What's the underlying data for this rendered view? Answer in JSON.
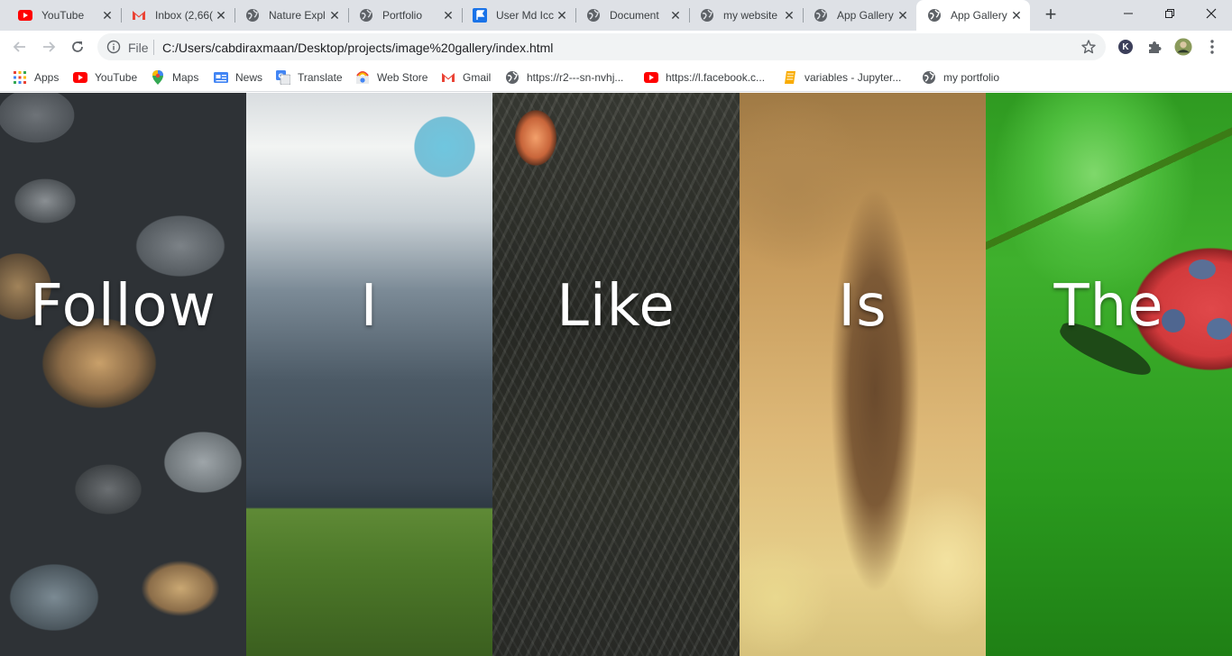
{
  "browser": {
    "tabs": [
      {
        "title": "YouTube",
        "icon": "youtube-icon",
        "active": false
      },
      {
        "title": "Inbox (2,66(",
        "icon": "gmail-icon",
        "active": false
      },
      {
        "title": "Nature Expl",
        "icon": "globe-icon",
        "active": false
      },
      {
        "title": "Portfolio",
        "icon": "globe-icon",
        "active": false
      },
      {
        "title": "User Md Icc",
        "icon": "flag-icon",
        "active": false
      },
      {
        "title": "Document",
        "icon": "globe-icon",
        "active": false
      },
      {
        "title": "my website",
        "icon": "globe-icon",
        "active": false
      },
      {
        "title": "App Gallery",
        "icon": "globe-icon",
        "active": false
      },
      {
        "title": "App Gallery",
        "icon": "globe-icon",
        "active": true
      }
    ],
    "address": {
      "scheme_label": "File",
      "url": "C:/Users/cabdiraxmaan/Desktop/projects/image%20gallery/index.html"
    },
    "profile_initial": "K",
    "bookmarks": [
      {
        "label": "Apps",
        "icon": "apps-grid-icon"
      },
      {
        "label": "YouTube",
        "icon": "youtube-icon"
      },
      {
        "label": "Maps",
        "icon": "maps-pin-icon"
      },
      {
        "label": "News",
        "icon": "news-icon"
      },
      {
        "label": "Translate",
        "icon": "translate-icon"
      },
      {
        "label": "Web Store",
        "icon": "webstore-icon"
      },
      {
        "label": "Gmail",
        "icon": "gmail-icon"
      },
      {
        "label": "https://r2---sn-nvhj...",
        "icon": "globe-icon"
      },
      {
        "label": "https://l.facebook.c...",
        "icon": "youtube-icon"
      },
      {
        "label": "variables - Jupyter...",
        "icon": "jupyter-icon"
      },
      {
        "label": "my portfolio",
        "icon": "globe-icon"
      }
    ]
  },
  "gallery": {
    "panels": [
      {
        "word": "Follow",
        "image": "pebbles"
      },
      {
        "word": "I",
        "image": "sky-and-grass"
      },
      {
        "word": "Like",
        "image": "tree-bark"
      },
      {
        "word": "Is",
        "image": "autumn-tree"
      },
      {
        "word": "The",
        "image": "ladybug"
      }
    ]
  },
  "colors": {
    "tabstrip": "#dee1e6",
    "youtube_red": "#ff0000",
    "accent_blue": "#1a73e8"
  }
}
